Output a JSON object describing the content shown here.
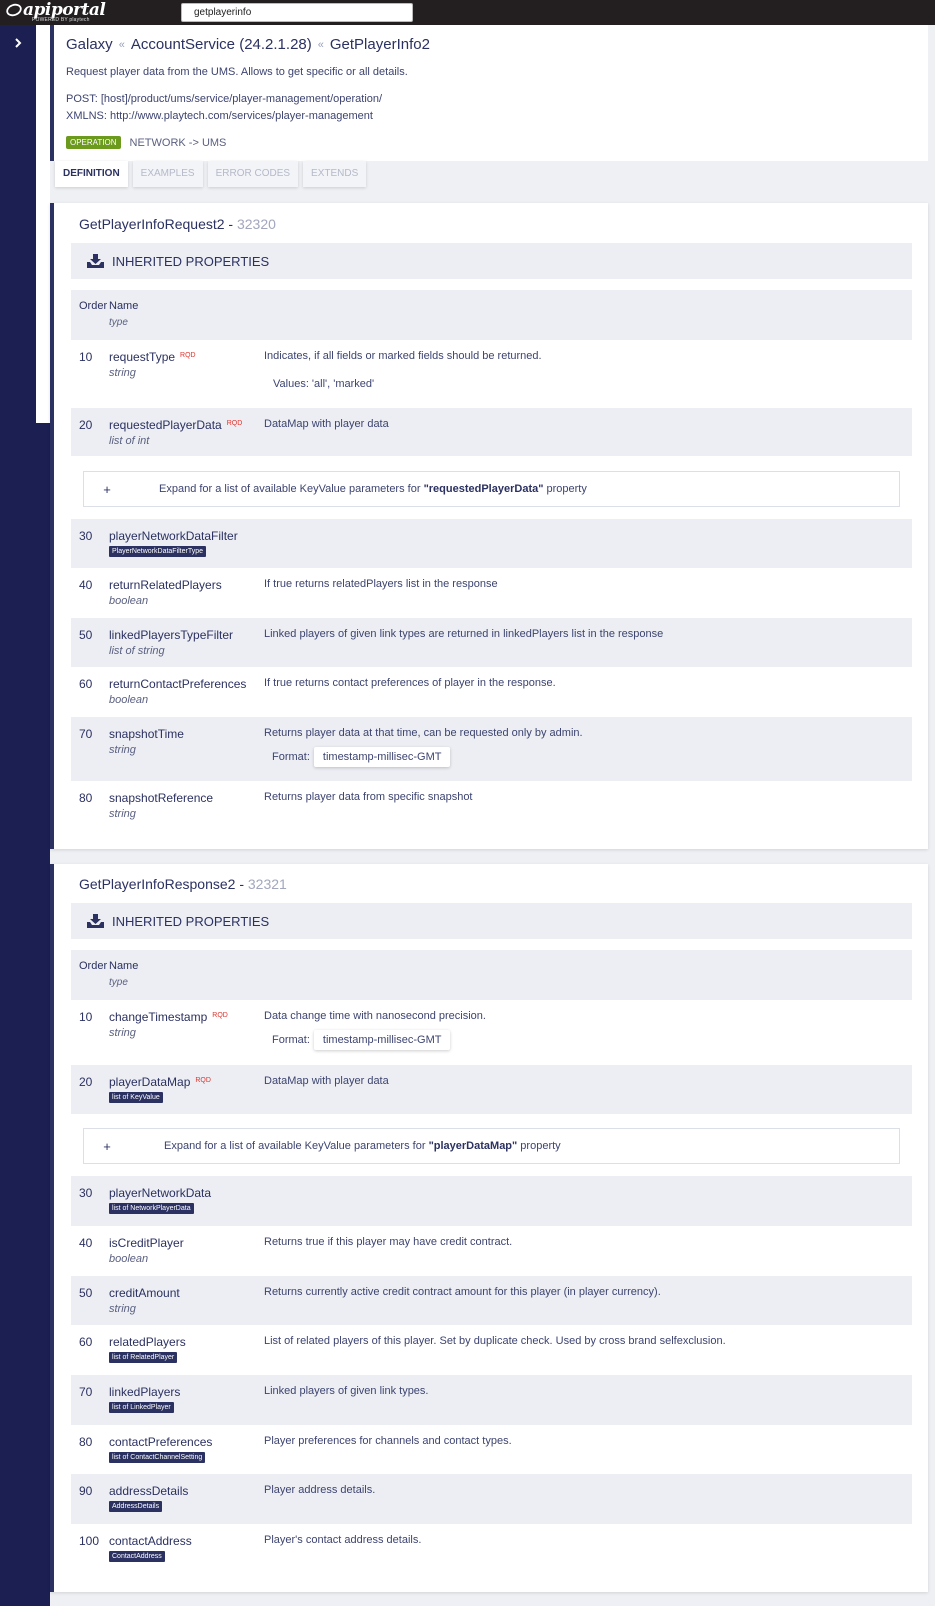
{
  "app": {
    "logo_text": "apiportal",
    "logo_sub": "POWERED BY playtech"
  },
  "search": {
    "value": "getplayerinfo"
  },
  "breadcrumb": {
    "root": "Galaxy",
    "service": "AccountService (24.2.1.28)",
    "operation": "GetPlayerInfo2",
    "separator": "«"
  },
  "header": {
    "description": "Request player data from the UMS. Allows to get specific or all details.",
    "post": "POST: [host]/product/ums/service/player-management/operation/",
    "xmlns": "XMLNS: http://www.playtech.com/services/player-management",
    "badge": "OPERATION",
    "network": "NETWORK -> UMS"
  },
  "tabs": [
    "DEFINITION",
    "EXAMPLES",
    "ERROR CODES",
    "EXTENDS"
  ],
  "columns": {
    "order": "Order",
    "name": "Name",
    "type": "type"
  },
  "rqd_label": "RQD",
  "inherited_label": "INHERITED PROPERTIES",
  "request": {
    "title": "GetPlayerInfoRequest2 - ",
    "code": "32320",
    "rows": [
      {
        "order": "10",
        "name": "requestType",
        "type": "string",
        "desc": "Indicates, if all fields or marked fields should be returned.",
        "values": "Values: 'all', 'marked'"
      },
      {
        "order": "20",
        "name": "requestedPlayerData",
        "type": "list of int",
        "desc": "DataMap with player data"
      },
      {
        "order": "30",
        "name": "playerNetworkDataFilter",
        "type": "PlayerNetworkDataFilterType",
        "desc": ""
      },
      {
        "order": "40",
        "name": "returnRelatedPlayers",
        "type": "boolean",
        "desc": "If true returns relatedPlayers list in the response"
      },
      {
        "order": "50",
        "name": "linkedPlayersTypeFilter",
        "type": "list of string",
        "desc": "Linked players of given link types are returned in linkedPlayers list in the response"
      },
      {
        "order": "60",
        "name": "returnContactPreferences",
        "type": "boolean",
        "desc": "If true returns contact preferences of player in the response."
      },
      {
        "order": "70",
        "name": "snapshotTime",
        "type": "string",
        "desc": "Returns player data at that time, can be requested only by admin.",
        "format_label": "Format:",
        "format": "timestamp-millisec-GMT"
      },
      {
        "order": "80",
        "name": "snapshotReference",
        "type": "string",
        "desc": "Returns player data from specific snapshot"
      }
    ],
    "expand": {
      "prefix": "Expand for a list of available KeyValue parameters for ",
      "prop": "\"requestedPlayerData\"",
      "suffix": " property"
    }
  },
  "response": {
    "title": "GetPlayerInfoResponse2 - ",
    "code": "32321",
    "rows": [
      {
        "order": "10",
        "name": "changeTimestamp",
        "type": "string",
        "desc": "Data change time with nanosecond precision.",
        "format_label": "Format:",
        "format": "timestamp-millisec-GMT"
      },
      {
        "order": "20",
        "name": "playerDataMap",
        "type": "list of KeyValue",
        "desc": "DataMap with player data"
      },
      {
        "order": "30",
        "name": "playerNetworkData",
        "type": "list of NetworkPlayerData",
        "desc": ""
      },
      {
        "order": "40",
        "name": "isCreditPlayer",
        "type": "boolean",
        "desc": "Returns true if this player may have credit contract."
      },
      {
        "order": "50",
        "name": "creditAmount",
        "type": "string",
        "desc": "Returns currently active credit contract amount for this player (in player currency)."
      },
      {
        "order": "60",
        "name": "relatedPlayers",
        "type": "list of RelatedPlayer",
        "desc": "List of related players of this player. Set by duplicate check. Used by cross brand selfexclusion."
      },
      {
        "order": "70",
        "name": "linkedPlayers",
        "type": "list of LinkedPlayer",
        "desc": "Linked players of given link types."
      },
      {
        "order": "80",
        "name": "contactPreferences",
        "type": "list of ContactChannelSetting",
        "desc": "Player preferences for channels and contact types."
      },
      {
        "order": "90",
        "name": "addressDetails",
        "type": "AddressDetails",
        "desc": "Player address details."
      },
      {
        "order": "100",
        "name": "contactAddress",
        "type": "ContactAddress",
        "desc": "Player's contact address details."
      }
    ],
    "expand": {
      "prefix": "Expand for a list of available KeyValue parameters for ",
      "prop": "\"playerDataMap\"",
      "suffix": " property"
    }
  },
  "colors": {
    "navy": "#2b3161",
    "sidebar": "#1b1f52",
    "rqd": "#e0322b",
    "operation": "#6b9a1c"
  }
}
